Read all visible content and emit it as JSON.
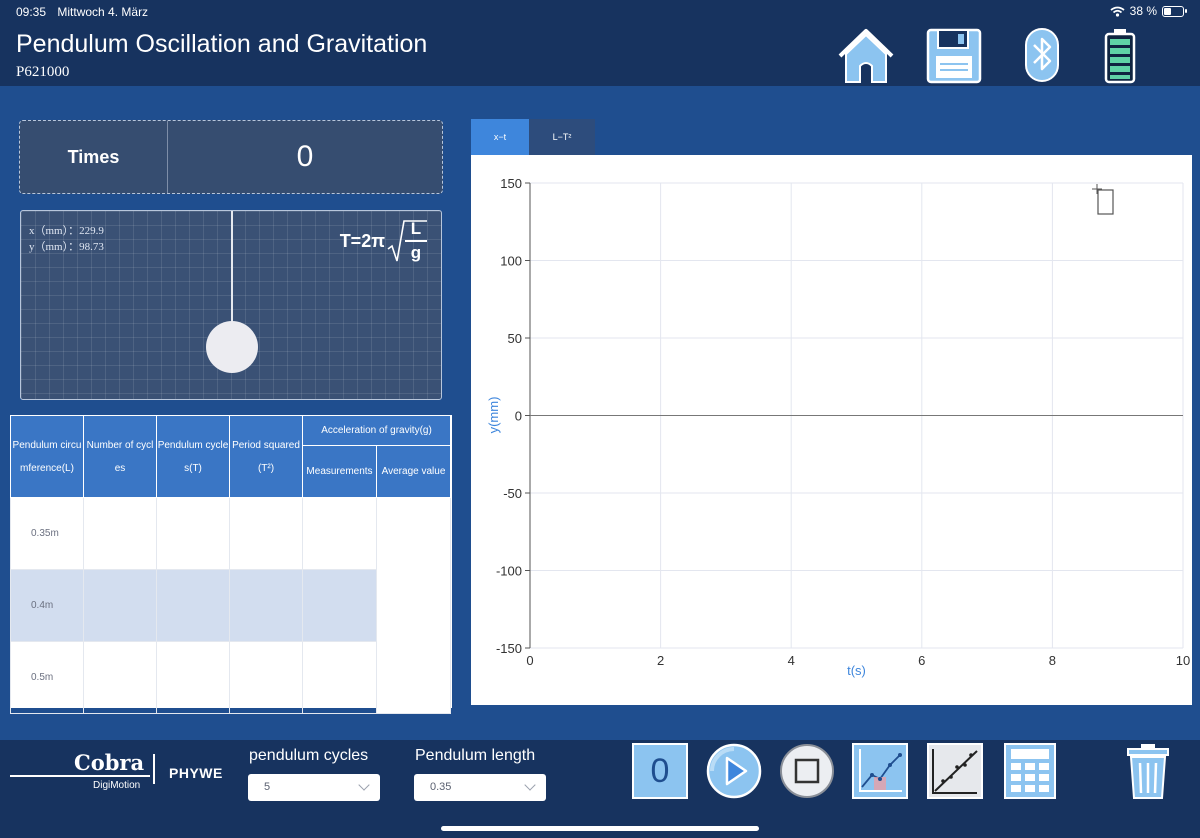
{
  "status_bar": {
    "time": "09:35",
    "date": "Mittwoch 4. März",
    "battery": "38 %",
    "battery_level": 0.38
  },
  "header": {
    "title": "Pendulum Oscillation and Gravitation",
    "code": "P621000"
  },
  "times": {
    "label": "Times",
    "value": "0"
  },
  "simulation": {
    "x_readout": "x（mm）：229.9",
    "y_readout": "y（mm）：98.73",
    "formula_prefix": "T=2π",
    "formula_num": "L",
    "formula_den": "g"
  },
  "table": {
    "headers": {
      "col1": "Pendulum circumference(L)",
      "col2": "Number of cycles",
      "col3": "Pendulum cycles(T)",
      "col4": "Period squared(T²)",
      "group": "Acceleration of gravity(g)",
      "col5": "Measurements",
      "col6": "Average value"
    },
    "rows": [
      {
        "length": "0.35m"
      },
      {
        "length": "0.4m"
      },
      {
        "length": "0.5m"
      }
    ]
  },
  "chart_tabs": [
    {
      "label": "x−t",
      "active": true
    },
    {
      "label": "L−T²",
      "active": false
    }
  ],
  "chart_data": {
    "type": "line",
    "title": "",
    "xlabel": "t(s)",
    "ylabel": "y(mm)",
    "xlim": [
      0,
      10
    ],
    "ylim": [
      -150,
      150
    ],
    "x_ticks": [
      "0",
      "2",
      "4",
      "6",
      "8",
      "10"
    ],
    "y_ticks": [
      "150",
      "100",
      "50",
      "0",
      "-50",
      "-100",
      "-150"
    ],
    "grid": true,
    "series": []
  },
  "bottom": {
    "logo_cobra": "Cobra",
    "logo_digimotion": "DigiMotion",
    "logo_phywe": "PHYWE",
    "cycles_label": "pendulum cycles",
    "cycles_value": "5",
    "length_label": "Pendulum length",
    "length_value": "0.35",
    "counter_value": "0"
  },
  "icons": {
    "home": "home-icon",
    "save": "save-icon",
    "bluetooth": "bluetooth-icon",
    "battery": "battery-icon",
    "play": "play-icon",
    "stop": "stop-icon",
    "chart": "chart-icon",
    "fit": "line-fit-icon",
    "calculator": "calculator-icon",
    "trash": "trash-icon"
  }
}
